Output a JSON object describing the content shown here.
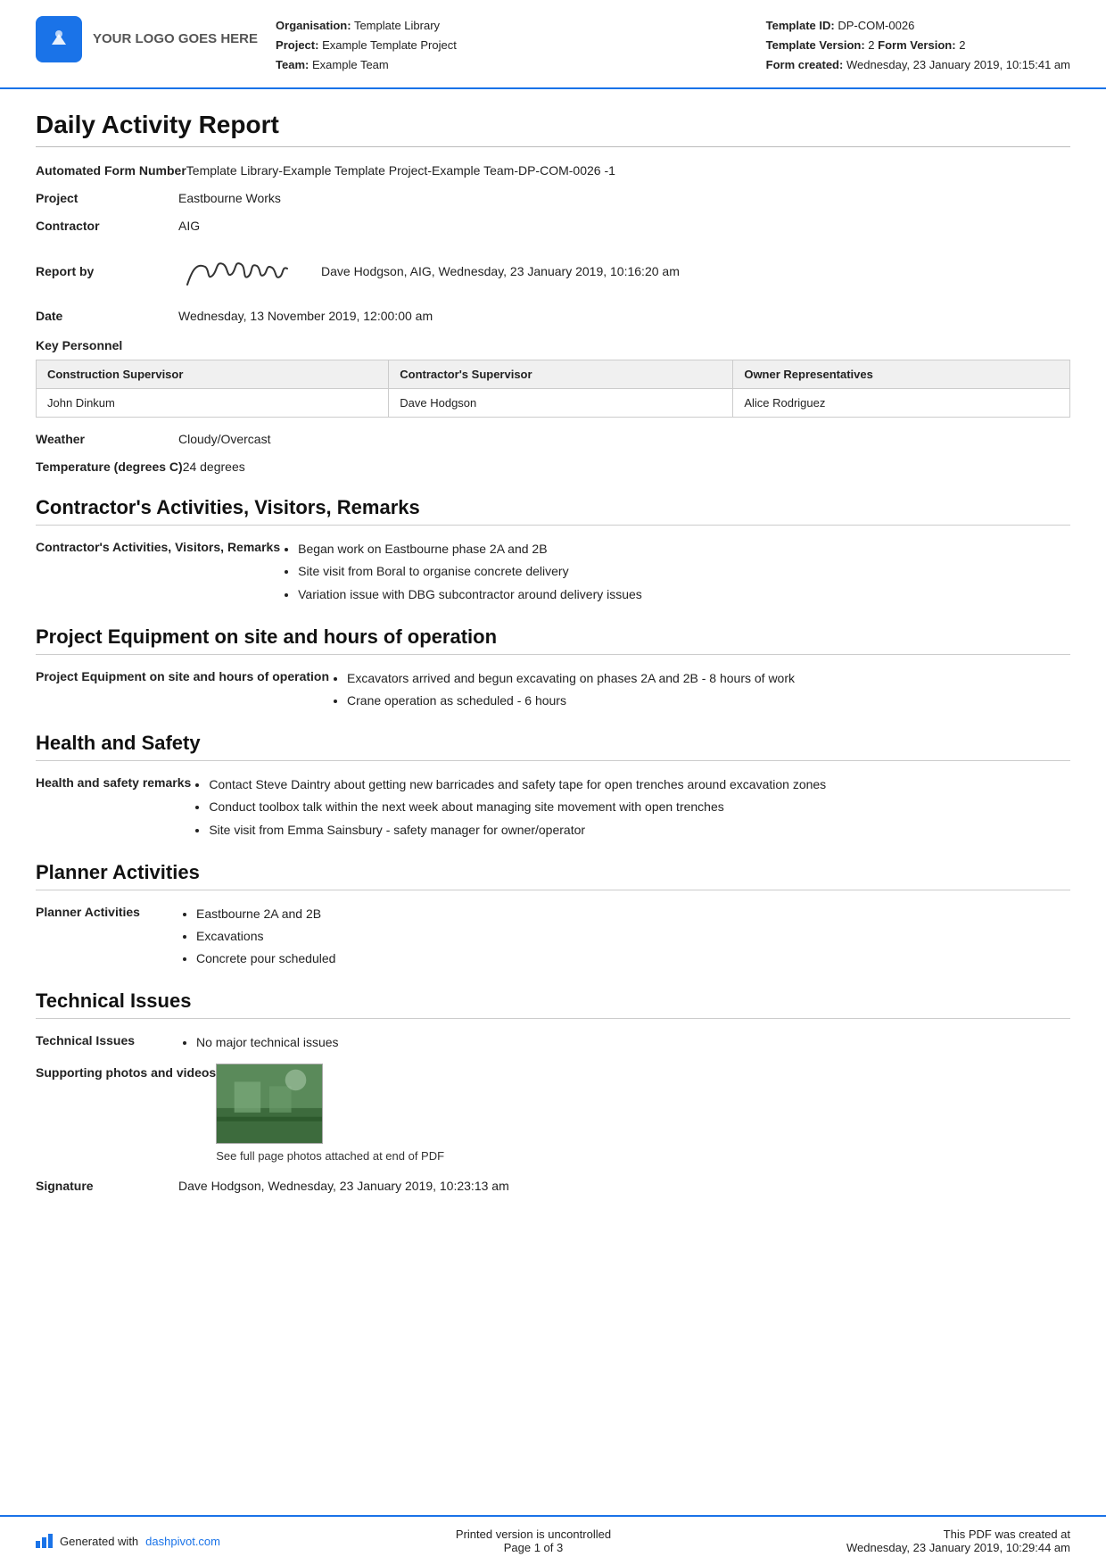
{
  "header": {
    "logo_text": "YOUR LOGO GOES HERE",
    "org_label": "Organisation:",
    "org_value": "Template Library",
    "project_label": "Project:",
    "project_value": "Example Template Project",
    "team_label": "Team:",
    "team_value": "Example Team",
    "template_id_label": "Template ID:",
    "template_id_value": "DP-COM-0026",
    "template_version_label": "Template Version:",
    "template_version_value": "2",
    "form_version_label": "Form Version:",
    "form_version_value": "2",
    "form_created_label": "Form created:",
    "form_created_value": "Wednesday, 23 January 2019, 10:15:41 am"
  },
  "report": {
    "title": "Daily Activity Report",
    "automated_form_label": "Automated Form Number",
    "automated_form_value": "Template Library-Example Template Project-Example Team-DP-COM-0026   -1",
    "project_label": "Project",
    "project_value": "Eastbourne Works",
    "contractor_label": "Contractor",
    "contractor_value": "AIG",
    "report_by_label": "Report by",
    "report_by_value": "Dave Hodgson, AIG, Wednesday, 23 January 2019, 10:16:20 am",
    "date_label": "Date",
    "date_value": "Wednesday, 13 November 2019, 12:00:00 am"
  },
  "key_personnel": {
    "label": "Key Personnel",
    "columns": [
      "Construction Supervisor",
      "Contractor's Supervisor",
      "Owner Representatives"
    ],
    "rows": [
      [
        "John Dinkum",
        "Dave Hodgson",
        "Alice Rodriguez"
      ]
    ]
  },
  "weather": {
    "label": "Weather",
    "value": "Cloudy/Overcast"
  },
  "temperature": {
    "label": "Temperature (degrees C)",
    "value": "24 degrees"
  },
  "contractors_activities": {
    "section_title": "Contractor's Activities, Visitors, Remarks",
    "field_label": "Contractor's Activities, Visitors, Remarks",
    "items": [
      "Began work on Eastbourne phase 2A and 2B",
      "Site visit from Boral to organise concrete delivery",
      "Variation issue with DBG subcontractor around delivery issues"
    ]
  },
  "project_equipment": {
    "section_title": "Project Equipment on site and hours of operation",
    "field_label": "Project Equipment on site and hours of operation",
    "items": [
      "Excavators arrived and begun excavating on phases 2A and 2B - 8 hours of work",
      "Crane operation as scheduled - 6 hours"
    ]
  },
  "health_safety": {
    "section_title": "Health and Safety",
    "field_label": "Health and safety remarks",
    "items": [
      "Contact Steve Daintry about getting new barricades and safety tape for open trenches around excavation zones",
      "Conduct toolbox talk within the next week about managing site movement with open trenches",
      "Site visit from Emma Sainsbury - safety manager for owner/operator"
    ]
  },
  "planner_activities": {
    "section_title": "Planner Activities",
    "field_label": "Planner Activities",
    "items": [
      "Eastbourne 2A and 2B",
      "Excavations",
      "Concrete pour scheduled"
    ]
  },
  "technical_issues": {
    "section_title": "Technical Issues",
    "field_label": "Technical Issues",
    "items": [
      "No major technical issues"
    ],
    "photos_label": "Supporting photos and videos",
    "photos_caption": "See full page photos attached at end of PDF"
  },
  "signature": {
    "label": "Signature",
    "value": "Dave Hodgson, Wednesday, 23 January 2019, 10:23:13 am"
  },
  "footer": {
    "generated_text": "Generated with ",
    "dashpivot_link": "dashpivot.com",
    "center_text": "Printed version is uncontrolled",
    "page_text": "Page 1 of 3",
    "right_text": "This PDF was created at",
    "right_date": "Wednesday, 23 January 2019, 10:29:44 am"
  }
}
